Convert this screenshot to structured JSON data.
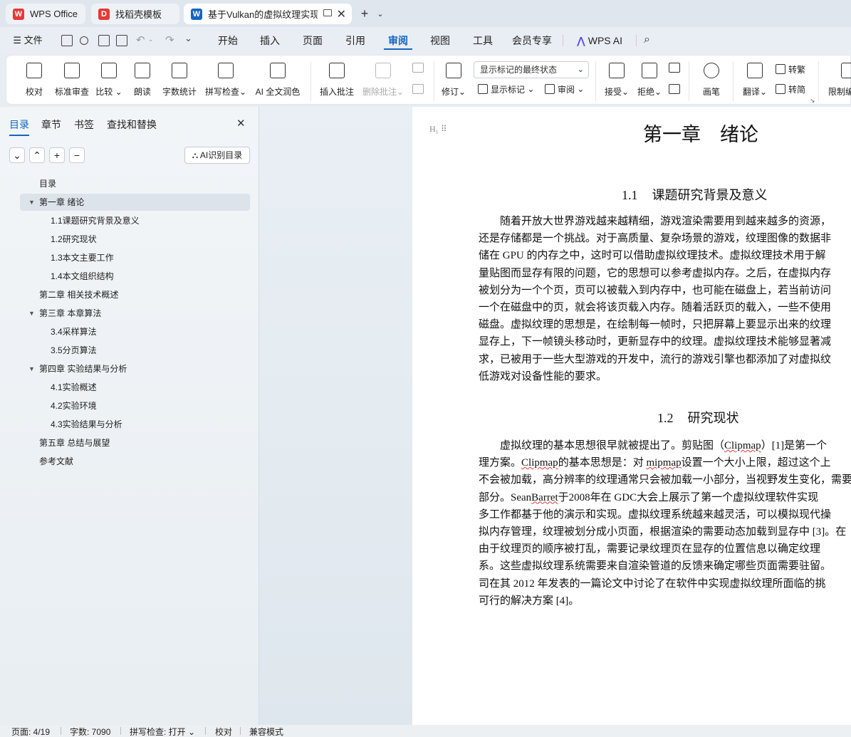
{
  "tabs": [
    {
      "label": "WPS Office",
      "logo": "W",
      "color": "#e53935"
    },
    {
      "label": "找稻壳模板",
      "logo": "D",
      "color": "#e53935"
    },
    {
      "label": "基于Vulkan的虚拟纹理实现",
      "logo": "W",
      "color": "#1565c0"
    }
  ],
  "menubar": {
    "file": "文件",
    "items": [
      "开始",
      "插入",
      "页面",
      "引用",
      "审阅",
      "视图",
      "工具",
      "会员专享"
    ],
    "active": "审阅",
    "wps_ai": "WPS AI"
  },
  "ribbon": {
    "proofread": "校对",
    "std_review": "标准审查",
    "compare": "比较",
    "read_aloud": "朗读",
    "word_count": "字数统计",
    "spell_check": "拼写检查",
    "ai_polish": "AI 全文润色",
    "insert_comment": "插入批注",
    "delete_comment": "删除批注",
    "track_changes": "修订",
    "show_markup_select": "显示标记的最终状态",
    "show_markup": "显示标记",
    "review": "审阅",
    "accept": "接受",
    "reject": "拒绝",
    "pen": "画笔",
    "translate": "翻译",
    "to_traditional": "转繁",
    "to_simplified": "转简",
    "restrict": "限制编"
  },
  "nav": {
    "tabs": [
      "目录",
      "章节",
      "书签",
      "查找和替换"
    ],
    "ai_toc": "AI识别目录",
    "toc": [
      {
        "label": "目录",
        "level": 1,
        "arrow": false
      },
      {
        "label": "第一章 绪论",
        "level": 1,
        "arrow": true,
        "selected": true
      },
      {
        "label": "1.1课题研究背景及意义",
        "level": 2
      },
      {
        "label": "1.2研究现状",
        "level": 2
      },
      {
        "label": "1.3本文主要工作",
        "level": 2
      },
      {
        "label": "1.4本文组织结构",
        "level": 2
      },
      {
        "label": "第二章 相关技术概述",
        "level": 1,
        "arrow": false
      },
      {
        "label": "第三章 本章算法",
        "level": 1,
        "arrow": true
      },
      {
        "label": "3.4采样算法",
        "level": 2
      },
      {
        "label": "3.5分页算法",
        "level": 2
      },
      {
        "label": "第四章 实验结果与分析",
        "level": 1,
        "arrow": true
      },
      {
        "label": "4.1实验概述",
        "level": 2
      },
      {
        "label": "4.2实验环境",
        "level": 2
      },
      {
        "label": "4.3实验结果与分析",
        "level": 2
      },
      {
        "label": "第五章 总结与展望",
        "level": 1,
        "arrow": false
      },
      {
        "label": "参考文献",
        "level": 1,
        "arrow": false
      }
    ]
  },
  "doc": {
    "chapter_title": "第一章　绪论",
    "sec1_num": "1.1",
    "sec1_title": "课题研究背景及意义",
    "sec1_lines": [
      "　　随着开放大世界游戏越来越精细，游戏渲染需要用到越来越多的资源，",
      "还是存储都是一个挑战。对于高质量、复杂场景的游戏，纹理图像的数据非",
      "储在 GPU 的内存之中，这时可以借助虚拟纹理技术。虚拟纹理技术用于解",
      "量贴图而显存有限的问题，它的思想可以参考虚拟内存。之后，在虚拟内存",
      "被划分为一个个页，页可以被载入到内存中，也可能在磁盘上，若当前访问",
      "一个在磁盘中的页，就会将该页载入内存。随着活跃页的载入，一些不使用",
      "磁盘。虚拟纹理的思想是，在绘制每一帧时，只把屏幕上要显示出来的纹理",
      "显存上，下一帧镜头移动时，更新显存中的纹理。虚拟纹理技术能够显著减",
      "求，已被用于一些大型游戏的开发中，流行的游戏引擎也都添加了对虚拟纹",
      "低游戏对设备性能的要求。"
    ],
    "sec2_num": "1.2",
    "sec2_title": "研究现状",
    "sec2_lines": [
      [
        "　　虚拟纹理的基本思想很早就被提出了。剪贴图（",
        {
          "w": "Clipmap"
        },
        "）[1]是第一个"
      ],
      [
        "理方案。",
        {
          "w": "Clipmap"
        },
        "的基本思想是：对 ",
        {
          "w": "mipmap"
        },
        "设置一个大小上限，超过这个上"
      ],
      [
        "不会被加载，高分辨率的纹理通常只会被加载一小部分，当视野发生变化，需要"
      ],
      [
        "部分。Sean",
        {
          "w": "Barret"
        },
        "于2008年在 GDC大会上展示了第一个虚拟纹理软件实现"
      ],
      [
        "多工作都基于他的演示和实现。虚拟纹理系统越来越灵活，可以模拟现代操"
      ],
      [
        "拟内存管理，纹理被划分成小页面，根据渲染的需要动态加载到显存中 [3]。在"
      ],
      [
        "由于纹理页的顺序被打乱，需要记录纹理页在显存的位置信息以确定纹理"
      ],
      [
        "系。这些虚拟纹理系统需要来自渲染管道的反馈来确定哪些页面需要驻留。"
      ],
      [
        "司在其 2012 年发表的一篇论文中讨论了在软件中实现虚拟纹理所面临的挑"
      ],
      [
        "可行的解决方案 [4]。"
      ]
    ]
  },
  "status": {
    "page": "页面: 4/19",
    "words": "字数: 7090",
    "spell": "拼写检查: 打开",
    "proof": "校对",
    "compat": "兼容模式"
  }
}
